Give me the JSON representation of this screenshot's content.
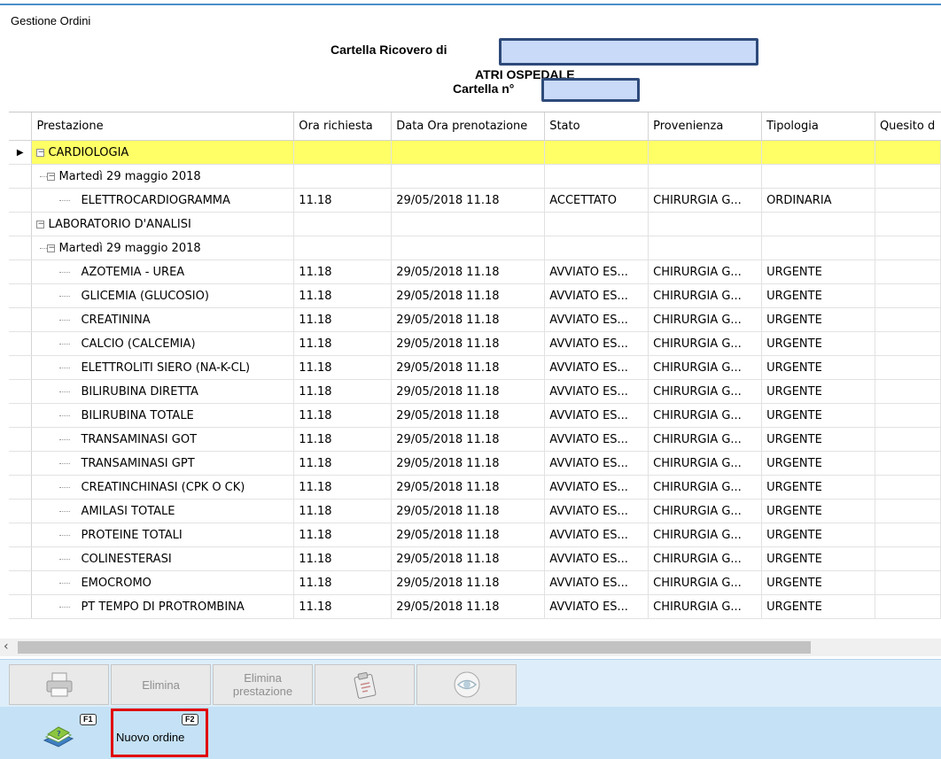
{
  "window": {
    "title": "Gestione Ordini"
  },
  "header": {
    "line1": "Cartella Ricovero di",
    "line2": "ATRI OSPEDALE",
    "line3": "Cartella n°"
  },
  "table": {
    "columns": [
      "Prestazione",
      "Ora richiesta",
      "Data Ora prenotazione",
      "Stato",
      "Provenienza",
      "Tipologia",
      "Quesito d"
    ],
    "groups": [
      {
        "name": "CARDIOLOGIA",
        "date": "Martedì 29 maggio 2018",
        "rows": [
          [
            "ELETTROCARDIOGRAMMA",
            "11.18",
            "29/05/2018 11.18",
            "ACCETTATO",
            "CHIRURGIA G...",
            "ORDINARIA",
            ""
          ]
        ]
      },
      {
        "name": "LABORATORIO D'ANALISI",
        "date": "Martedì 29 maggio 2018",
        "rows": [
          [
            "AZOTEMIA - UREA",
            "11.18",
            "29/05/2018 11.18",
            "AVVIATO ES...",
            "CHIRURGIA G...",
            "URGENTE",
            ""
          ],
          [
            "GLICEMIA (GLUCOSIO)",
            "11.18",
            "29/05/2018 11.18",
            "AVVIATO ES...",
            "CHIRURGIA G...",
            "URGENTE",
            ""
          ],
          [
            "CREATININA",
            "11.18",
            "29/05/2018 11.18",
            "AVVIATO ES...",
            "CHIRURGIA G...",
            "URGENTE",
            ""
          ],
          [
            "CALCIO (CALCEMIA)",
            "11.18",
            "29/05/2018 11.18",
            "AVVIATO ES...",
            "CHIRURGIA G...",
            "URGENTE",
            ""
          ],
          [
            "ELETTROLITI SIERO (NA-K-CL)",
            "11.18",
            "29/05/2018 11.18",
            "AVVIATO ES...",
            "CHIRURGIA G...",
            "URGENTE",
            ""
          ],
          [
            "BILIRUBINA DIRETTA",
            "11.18",
            "29/05/2018 11.18",
            "AVVIATO ES...",
            "CHIRURGIA G...",
            "URGENTE",
            ""
          ],
          [
            "BILIRUBINA TOTALE",
            "11.18",
            "29/05/2018 11.18",
            "AVVIATO ES...",
            "CHIRURGIA G...",
            "URGENTE",
            ""
          ],
          [
            "TRANSAMINASI GOT",
            "11.18",
            "29/05/2018 11.18",
            "AVVIATO ES...",
            "CHIRURGIA G...",
            "URGENTE",
            ""
          ],
          [
            "TRANSAMINASI GPT",
            "11.18",
            "29/05/2018 11.18",
            "AVVIATO ES...",
            "CHIRURGIA G...",
            "URGENTE",
            ""
          ],
          [
            "CREATINCHINASI (CPK O CK)",
            "11.18",
            "29/05/2018 11.18",
            "AVVIATO ES...",
            "CHIRURGIA G...",
            "URGENTE",
            ""
          ],
          [
            "AMILASI TOTALE",
            "11.18",
            "29/05/2018 11.18",
            "AVVIATO ES...",
            "CHIRURGIA G...",
            "URGENTE",
            ""
          ],
          [
            "PROTEINE TOTALI",
            "11.18",
            "29/05/2018 11.18",
            "AVVIATO ES...",
            "CHIRURGIA G...",
            "URGENTE",
            ""
          ],
          [
            "COLINESTERASI",
            "11.18",
            "29/05/2018 11.18",
            "AVVIATO ES...",
            "CHIRURGIA G...",
            "URGENTE",
            ""
          ],
          [
            "EMOCROMO",
            "11.18",
            "29/05/2018 11.18",
            "AVVIATO ES...",
            "CHIRURGIA G...",
            "URGENTE",
            ""
          ],
          [
            "PT TEMPO DI PROTROMBINA",
            "11.18",
            "29/05/2018 11.18",
            "AVVIATO ES...",
            "CHIRURGIA G...",
            "URGENTE",
            ""
          ]
        ]
      }
    ]
  },
  "toolbar": {
    "print_icon": "printer-icon",
    "delete_label": "Elimina",
    "delete_service_label": "Elimina prestazione",
    "clipboard_icon": "clipboard-icon",
    "eye_icon": "eye-icon"
  },
  "fkeys": {
    "help_key": "F1",
    "help_icon": "help-book-icon",
    "new_key": "F2",
    "new_label": "Nuovo ordine"
  },
  "colors": {
    "selected_row": "#ffff66",
    "redaction_fill": "#c9daf8",
    "redaction_border": "#2e4a7a",
    "highlight_border": "#e00000"
  }
}
